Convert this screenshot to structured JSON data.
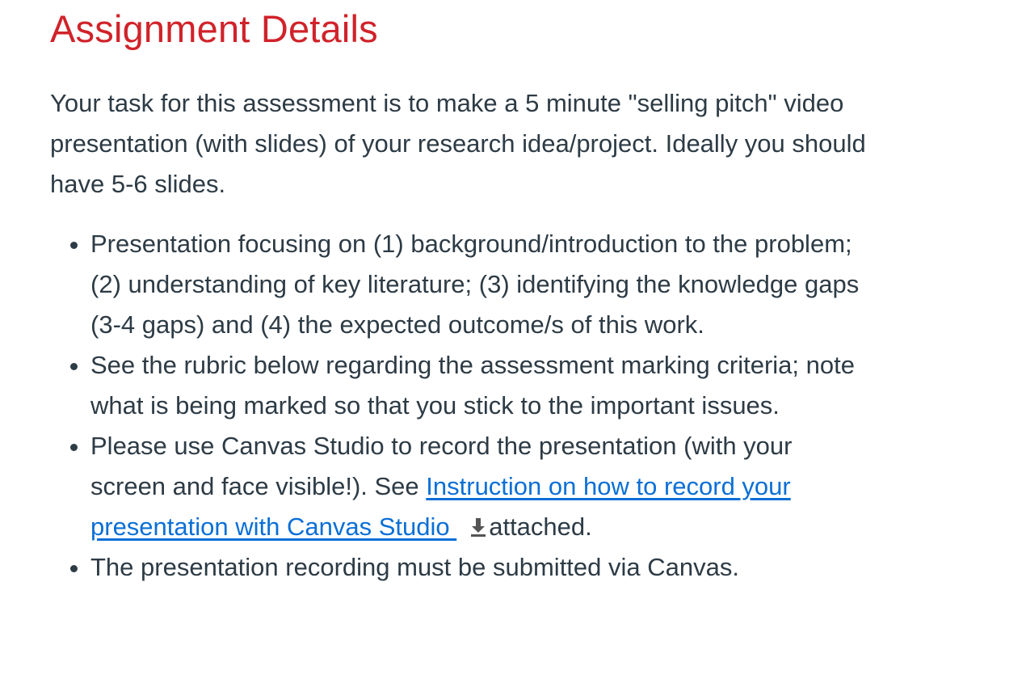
{
  "page": {
    "title": "Assignment Details"
  },
  "intro": {
    "text": "Your task for this assessment is to make a 5 minute \"selling pitch\" video presentation (with slides) of your research idea/project. Ideally you should have 5-6 slides."
  },
  "bullets": {
    "item1": "Presentation focusing on (1) background/introduction to the problem; (2) understanding of key literature; (3) identifying the knowledge gaps  (3-4 gaps) and (4) the expected outcome/s of this work.",
    "item2": "See the rubric below regarding the assessment marking criteria; note what is being marked so that you stick to the important issues.",
    "item3_prefix": "Please use Canvas Studio to record the presentation (with your screen and face visible!). See ",
    "item3_link": "Instruction on how to record your presentation with Canvas Studio ",
    "item3_suffix": "attached.",
    "item4": "The presentation recording must be submitted via Canvas."
  },
  "icons": {
    "download": "download-icon"
  },
  "colors": {
    "title": "#d0232a",
    "text": "#2d3b45",
    "link": "#0a6fd6",
    "icon": "#555555"
  }
}
